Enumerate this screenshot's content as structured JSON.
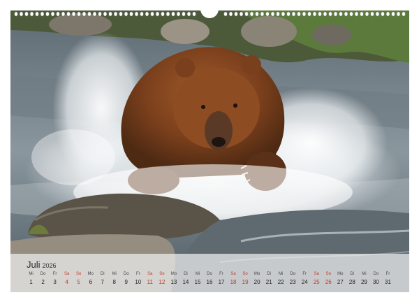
{
  "calendar": {
    "month": "Juli",
    "year": "2026",
    "weekend_color": "#c0392b",
    "days": [
      {
        "wd": "Mi",
        "d": "1",
        "we": false
      },
      {
        "wd": "Do",
        "d": "2",
        "we": false
      },
      {
        "wd": "Fr",
        "d": "3",
        "we": false
      },
      {
        "wd": "Sa",
        "d": "4",
        "we": true
      },
      {
        "wd": "So",
        "d": "5",
        "we": true
      },
      {
        "wd": "Mo",
        "d": "6",
        "we": false
      },
      {
        "wd": "Di",
        "d": "7",
        "we": false
      },
      {
        "wd": "Mi",
        "d": "8",
        "we": false
      },
      {
        "wd": "Do",
        "d": "9",
        "we": false
      },
      {
        "wd": "Fr",
        "d": "10",
        "we": false
      },
      {
        "wd": "Sa",
        "d": "11",
        "we": true
      },
      {
        "wd": "So",
        "d": "12",
        "we": true
      },
      {
        "wd": "Mo",
        "d": "13",
        "we": false
      },
      {
        "wd": "Di",
        "d": "14",
        "we": false
      },
      {
        "wd": "Mi",
        "d": "15",
        "we": false
      },
      {
        "wd": "Do",
        "d": "16",
        "we": false
      },
      {
        "wd": "Fr",
        "d": "17",
        "we": false
      },
      {
        "wd": "Sa",
        "d": "18",
        "we": true
      },
      {
        "wd": "So",
        "d": "19",
        "we": true
      },
      {
        "wd": "Mo",
        "d": "20",
        "we": false
      },
      {
        "wd": "Di",
        "d": "21",
        "we": false
      },
      {
        "wd": "Mi",
        "d": "22",
        "we": false
      },
      {
        "wd": "Do",
        "d": "23",
        "we": false
      },
      {
        "wd": "Fr",
        "d": "24",
        "we": false
      },
      {
        "wd": "Sa",
        "d": "25",
        "we": true
      },
      {
        "wd": "So",
        "d": "26",
        "we": true
      },
      {
        "wd": "Mo",
        "d": "27",
        "we": false
      },
      {
        "wd": "Di",
        "d": "28",
        "we": false
      },
      {
        "wd": "Mi",
        "d": "29",
        "we": false
      },
      {
        "wd": "Do",
        "d": "30",
        "we": false
      },
      {
        "wd": "Fr",
        "d": "31",
        "we": false
      }
    ]
  },
  "photo": {
    "subject": "brown-bear-icon",
    "water_color": "#d9dde0",
    "fur_color": "#8a4b22",
    "rock_color": "#5a5448"
  }
}
